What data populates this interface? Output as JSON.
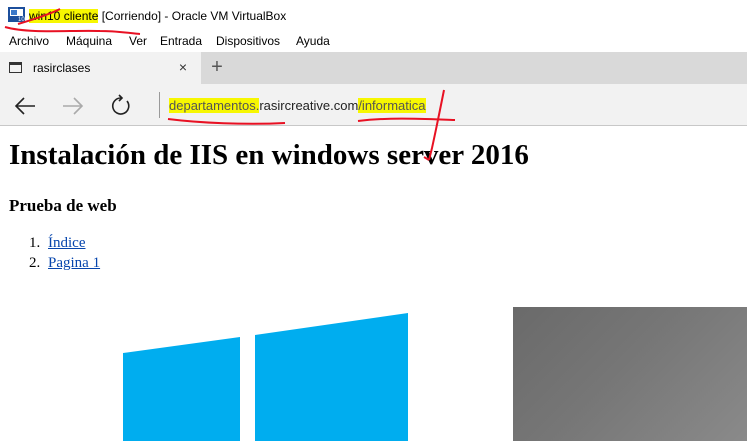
{
  "window": {
    "title_vm": "win10 cliente",
    "title_rest": "[Corriendo] - Oracle VM VirtualBox"
  },
  "menu": [
    "Archivo",
    "Máquina",
    "Ver",
    "Entrada",
    "Dispositivos",
    "Ayuda"
  ],
  "browser": {
    "tab_label": "rasirclases",
    "tab_close": "×",
    "new_tab": "+",
    "url_subdomain": "departamentos.",
    "url_domain": "rasircreative.com",
    "url_path": "/informatica"
  },
  "page": {
    "heading": "Instalación de IIS en windows server 2016",
    "subheading": "Prueba de web",
    "list": [
      {
        "num": "1.",
        "label": "Índice"
      },
      {
        "num": "2.",
        "label": "Pagina 1"
      }
    ]
  },
  "colors": {
    "highlight": "#f7f701",
    "annotation_red": "#e81123",
    "windows_blue": "#00adef",
    "link": "#0645ad"
  }
}
